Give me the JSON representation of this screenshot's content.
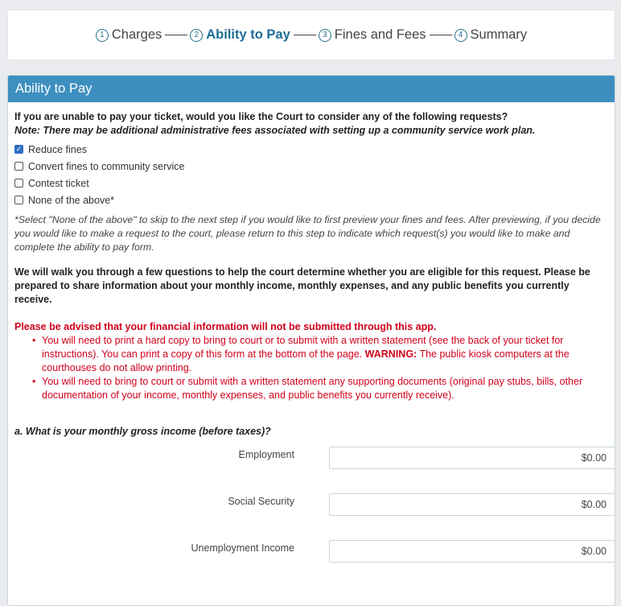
{
  "steps": [
    {
      "num": "1",
      "label": "Charges"
    },
    {
      "num": "2",
      "label": "Ability to Pay"
    },
    {
      "num": "3",
      "label": "Fines and Fees"
    },
    {
      "num": "4",
      "label": "Summary"
    }
  ],
  "panel": {
    "title": "Ability to Pay",
    "question": "If you are unable to pay your ticket, would you like the Court to consider any of the following requests?",
    "note": "Note: There may be additional administrative fees associated with setting up a community service work plan.",
    "options": [
      {
        "label": "Reduce fines",
        "checked": true
      },
      {
        "label": "Convert fines to community service",
        "checked": false
      },
      {
        "label": "Contest ticket",
        "checked": false
      },
      {
        "label": "None of the above*",
        "checked": false
      }
    ],
    "hint": "*Select \"None of the above\" to skip to the next step if you would like to first preview your fines and fees. After previewing, if you decide you would like to make a request to the court, please return to this step to indicate which request(s) you would like to make and complete the ability to pay form.",
    "walkthrough": "We will walk you through a few questions to help the court determine whether you are eligible for this request. Please be prepared to share information about your monthly income, monthly expenses, and any public benefits you currently receive.",
    "advise": "Please be advised that your financial information will not be submitted through this app.",
    "bullet1_a": "You will need to print a hard copy to bring to court or to submit with a written statement (see the back of your ticket for instructions). You can print a copy of this form at the bottom of the page. ",
    "bullet1_warning": "WARNING:",
    "bullet1_b": " The public kiosk computers at the courthouses do not allow printing.",
    "bullet2": "You will need to bring to court or submit with a written statement any supporting documents (original pay stubs, bills, other documentation of your income, monthly expenses, and public benefits you currently receive).",
    "income_question": "a. What is your monthly gross income (before taxes)?",
    "income_fields": [
      {
        "label": "Employment",
        "value": "$0.00"
      },
      {
        "label": "Social Security",
        "value": "$0.00"
      },
      {
        "label": "Unemployment Income",
        "value": "$0.00"
      }
    ]
  },
  "colors": {
    "header": "#3d8fbf",
    "active_step": "#1e6d96",
    "warning_red": "#d0021b",
    "checkbox": "#2f6fc2"
  }
}
